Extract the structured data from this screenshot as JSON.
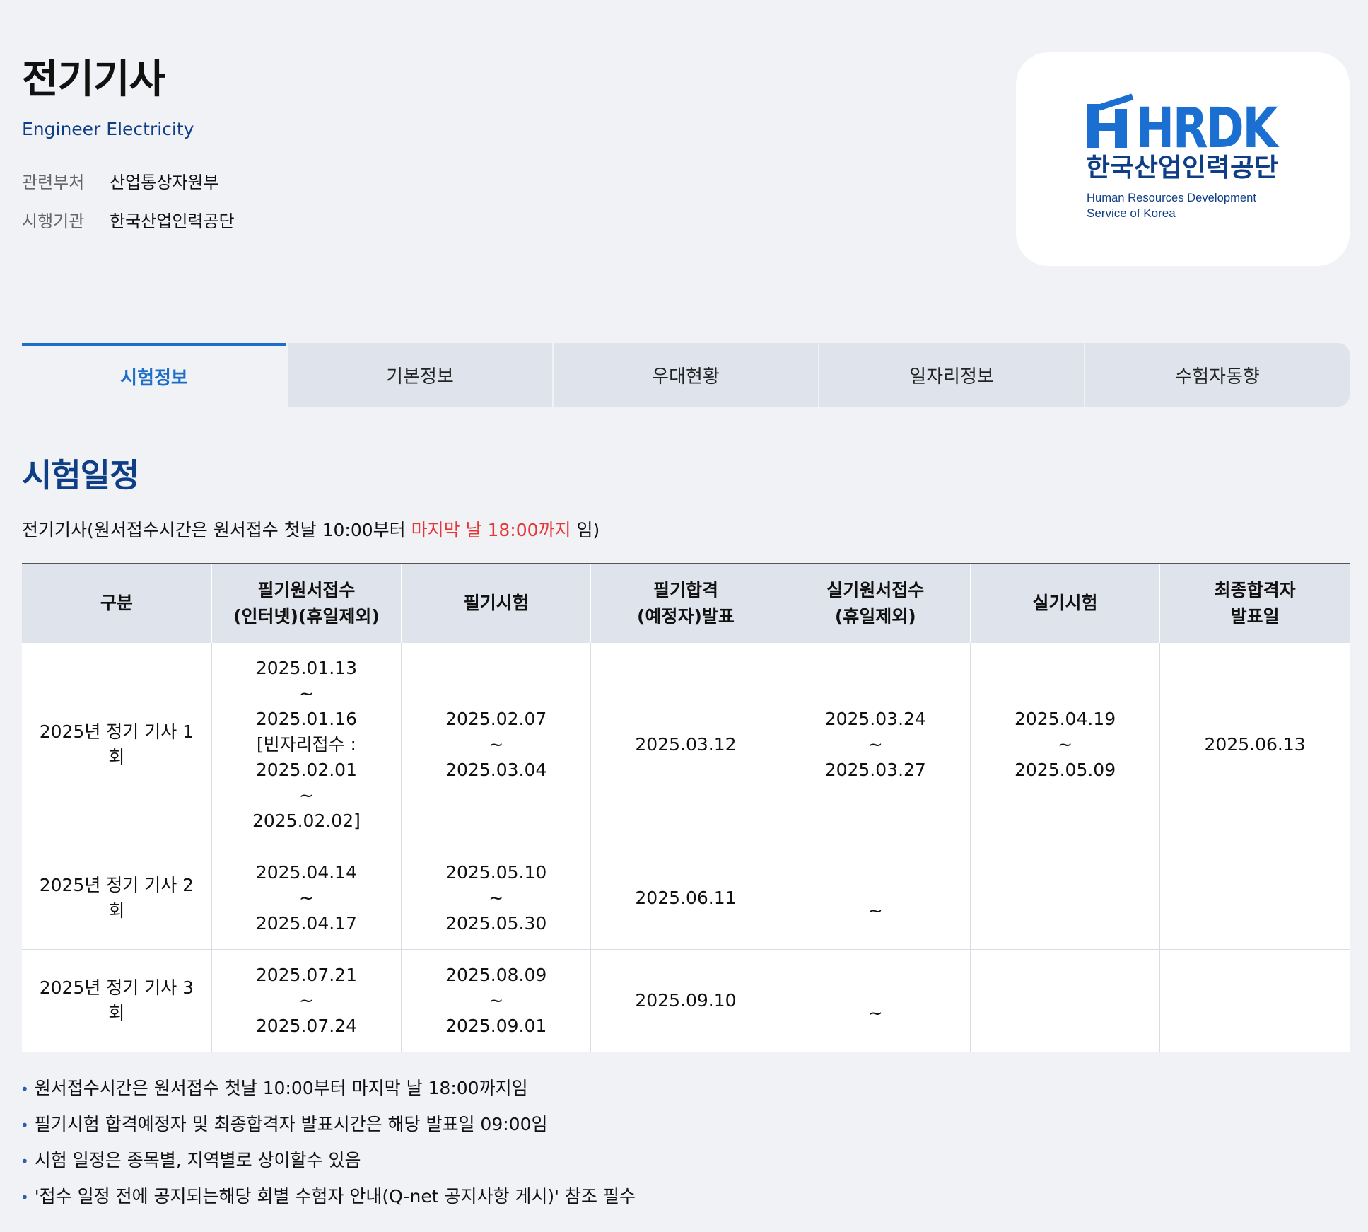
{
  "header": {
    "title": "전기기사",
    "subtitle": "Engineer Electricity",
    "meta": [
      {
        "label": "관련부처",
        "value": "산업통상자원부"
      },
      {
        "label": "시행기관",
        "value": "한국산업인력공단"
      }
    ]
  },
  "logo": {
    "icon": "hrdk-logo",
    "wordmark": "HRDK",
    "korean_name": "한국산업인력공단",
    "english_line1": "Human Resources Development",
    "english_line2": "Service of Korea",
    "brand_color": "#1b6fd1",
    "text_color": "#0d3e86"
  },
  "tabs": [
    {
      "label": "시험정보",
      "active": true
    },
    {
      "label": "기본정보",
      "active": false
    },
    {
      "label": "우대현황",
      "active": false
    },
    {
      "label": "일자리정보",
      "active": false
    },
    {
      "label": "수험자동향",
      "active": false
    }
  ],
  "section": {
    "title": "시험일정",
    "intro_before": "전기기사(원서접수시간은 원서접수 첫날 10:00부터 ",
    "intro_highlight": "마지막 날 18:00까지",
    "intro_after": " 임)"
  },
  "table": {
    "headers": [
      {
        "line1": "구분",
        "line2": ""
      },
      {
        "line1": "필기원서접수",
        "line2": "(인터넷)(휴일제외)"
      },
      {
        "line1": "필기시험",
        "line2": ""
      },
      {
        "line1": "필기합격",
        "line2": "(예정자)발표"
      },
      {
        "line1": "실기원서접수",
        "line2": "(휴일제외)"
      },
      {
        "line1": "실기시험",
        "line2": ""
      },
      {
        "line1": "최종합격자",
        "line2": "발표일"
      }
    ],
    "rows": [
      {
        "round_line1": "2025년 정기 기사 1",
        "round_line2": "회",
        "written_apply": [
          "2025.01.13",
          "~",
          "2025.01.16",
          "[빈자리접수 :",
          "2025.02.01",
          "~",
          "2025.02.02]"
        ],
        "written_exam": [
          "2025.02.07",
          "~",
          "2025.03.04"
        ],
        "written_result": [
          "2025.03.12"
        ],
        "practical_apply": [
          "2025.03.24",
          "~",
          "2025.03.27"
        ],
        "practical_exam": [
          "2025.04.19",
          "~",
          "2025.05.09"
        ],
        "final_result": [
          "2025.06.13"
        ]
      },
      {
        "round_line1": "2025년 정기 기사 2",
        "round_line2": "회",
        "written_apply": [
          "2025.04.14",
          "~",
          "2025.04.17"
        ],
        "written_exam": [
          "2025.05.10",
          "~",
          "2025.05.30"
        ],
        "written_result": [
          "2025.06.11"
        ],
        "practical_apply": [
          "~"
        ],
        "practical_exam": [],
        "final_result": []
      },
      {
        "round_line1": "2025년 정기 기사 3",
        "round_line2": "회",
        "written_apply": [
          "2025.07.21",
          "~",
          "2025.07.24"
        ],
        "written_exam": [
          "2025.08.09",
          "~",
          "2025.09.01"
        ],
        "written_result": [
          "2025.09.10"
        ],
        "practical_apply": [
          "~"
        ],
        "practical_exam": [],
        "final_result": []
      }
    ]
  },
  "notes": [
    "원서접수시간은 원서접수 첫날 10:00부터 마지막 날 18:00까지임",
    "필기시험 합격예정자 및 최종합격자 발표시간은 해당 발표일 09:00임",
    "시험 일정은 종목별, 지역별로 상이할수 있음",
    "'접수 일정 전에 공지되는해당 회별 수험자 안내(Q-net 공지사항 게시)' 참조 필수"
  ],
  "colors": {
    "background": "#f1f2f6",
    "accent": "#1d6ec9",
    "heading": "#0d3e86",
    "highlight": "#e53535",
    "tab_bg": "#dfe4ec"
  }
}
